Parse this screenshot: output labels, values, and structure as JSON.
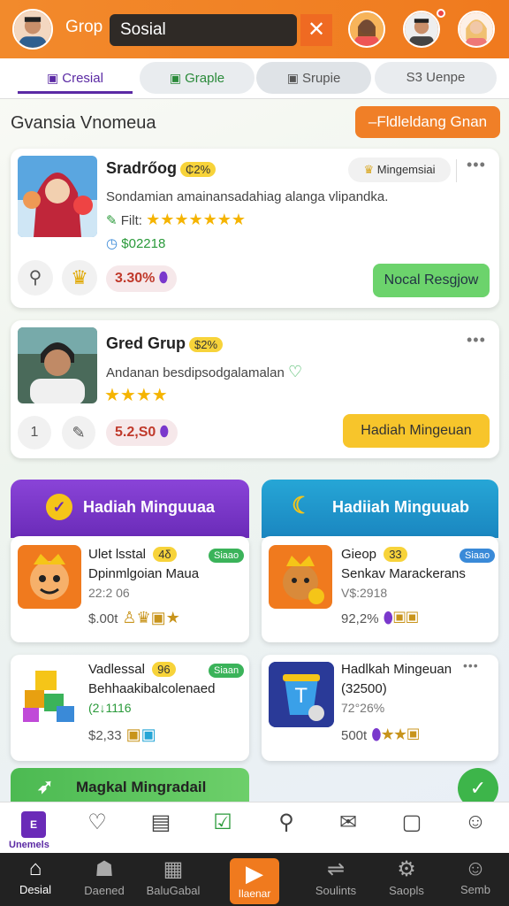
{
  "header": {
    "brand": "Grop",
    "search_value": "Sosial",
    "close_icon": "✕",
    "colors": {
      "bar": "#f28a2c"
    }
  },
  "tabs": [
    {
      "label": "Cresial",
      "icon": "▣"
    },
    {
      "label": "Graple",
      "icon": "▣"
    },
    {
      "label": "Srupie",
      "icon": "▣"
    },
    {
      "label": "S3 Uenpe"
    }
  ],
  "section": {
    "title": "Gvansia Vnomeua",
    "action": "–Fldleldang Gnan"
  },
  "cards": [
    {
      "title": "Sradrőog",
      "badge": "₵2%",
      "tag": "Mingemsiai",
      "desc": "Sondamian amainansadahiag alanga vlipandka.",
      "filter_label": "Filt:",
      "stars": "★★★★★★★",
      "price": "$02218",
      "amount": "3.30%",
      "button": "Nocal Resgjow"
    },
    {
      "title": "Gred Grup",
      "badge": "$2%",
      "desc": "Andanan besdipsodgalamalan",
      "stars": "★★★★",
      "chip_number": "1",
      "amount": "5.2,S0",
      "button": "Hadiah Mingeuan"
    }
  ],
  "panels": [
    {
      "title": "Hadiah Minguuaa",
      "color": "#7a38cc"
    },
    {
      "title": "Hadiiah Minguuab",
      "color": "#22a0d2"
    }
  ],
  "items": [
    {
      "title": "Ulet lsstal",
      "badge": "4δ",
      "tag": "Siaao",
      "line2": "Dpinmlgoian Maua",
      "sub": "22:2 06",
      "price": "$.00t"
    },
    {
      "title": "Gieop",
      "badge": "33",
      "tag": "Siaao",
      "line2": "Senkav Marackerans",
      "sub": "V$:2918",
      "price": "92,2%"
    },
    {
      "title": "Vadlessal",
      "badge": "96",
      "tag": "Siaan",
      "line2": "Behhaakibalcolenaed",
      "sub": "(2↓1116",
      "price": "$2,33"
    },
    {
      "title": "Hadlkah Mingeuan",
      "line2": "(32500)",
      "sub": "72°26%",
      "price": "500t"
    }
  ],
  "greenbar": {
    "label": "Magkal Mingradail"
  },
  "navbar": {
    "active_label": "Unemels",
    "active_letter": "E"
  },
  "bottom": [
    {
      "label": "Desial",
      "icon": "⌂"
    },
    {
      "label": "Daened",
      "icon": "☗"
    },
    {
      "label": "BaluGabal",
      "icon": "▦"
    },
    {
      "label": "Ilaenar",
      "icon": "▶"
    },
    {
      "label": "Soulints",
      "icon": "⇌"
    },
    {
      "label": "Saopls",
      "icon": "⚙"
    },
    {
      "label": "Semb",
      "icon": "☺"
    }
  ]
}
